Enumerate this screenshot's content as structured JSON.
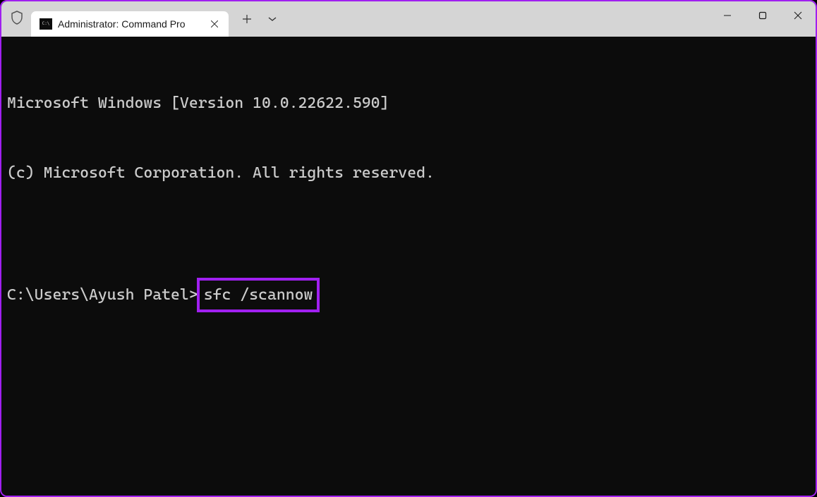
{
  "titlebar": {
    "tab_title": "Administrator: Command Pro"
  },
  "terminal": {
    "line1": "Microsoft Windows [Version 10.0.22622.590]",
    "line2": "(c) Microsoft Corporation. All rights reserved.",
    "blank": "",
    "prompt": "C:\\Users\\Ayush Patel>",
    "command": "sfc /scannow"
  },
  "colors": {
    "window_border": "#a020f0",
    "highlight_border": "#a020f0",
    "titlebar_bg": "#d5d5d5",
    "tab_bg": "#ffffff",
    "terminal_bg": "#0c0c0c",
    "terminal_fg": "#cccccc"
  }
}
